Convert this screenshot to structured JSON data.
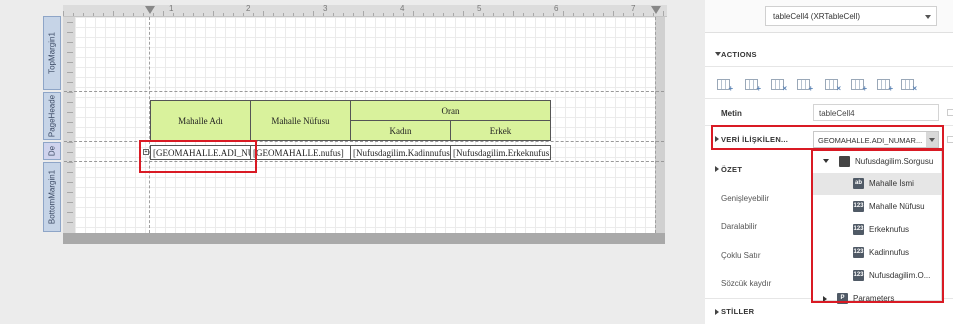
{
  "ruler": {
    "labels": [
      "1",
      "2",
      "3",
      "4",
      "5",
      "6",
      "7"
    ]
  },
  "bands": {
    "top_margin": "TopMargin1",
    "page_header": "PageHeade",
    "detail": "De",
    "bottom_margin": "BottomMargin1"
  },
  "table": {
    "headers": {
      "mahalle_adi": "Mahalle Adı",
      "mahalle_nufusu": "Mahalle Nüfusu",
      "oran": "Oran",
      "kadin": "Kadın",
      "erkek": "Erkek"
    },
    "detail_row": [
      "[GEOMAHALLE.ADI_NU",
      "[GEOMAHALLE.nufus]",
      "[Nufusdagilim.Kadinnufus]",
      "[Nufusdagilim.Erkeknufus]"
    ]
  },
  "colors": {
    "header_fill": "#d9f29c",
    "highlight": "#d91a24",
    "band_tab": "#c6d4e7"
  },
  "panel": {
    "selector_value": "tableCell4 (XRTableCell)",
    "actions_header": "ACTIONS",
    "action_icons": [
      "insert-row-above-icon",
      "insert-row-below-icon",
      "delete-row-icon",
      "insert-cell-icon",
      "delete-cell-icon",
      "insert-column-left-icon",
      "insert-column-right-icon",
      "delete-column-icon"
    ],
    "metin_label": "Metin",
    "metin_value": "tableCell4",
    "veri_iliskileri_label": "VERİ İLİŞKİLEN...",
    "veri_iliskileri_value": "GEOMAHALLE.ADI_NUMAR...",
    "ozet_label": "ÖZET",
    "genisleyebilir_label": "Genişleyebilir",
    "daralabilir_label": "Daralabilir",
    "coklu_satir_label": "Çoklu Satır",
    "sozcuk_kaydir_label": "Sözcük kaydır",
    "stiller_label": "STİLLER"
  },
  "tree": {
    "root": "Nufusdagilim.Sorgusu",
    "items": [
      {
        "label": "Mahalle İsmi",
        "icon": "ab",
        "selected": true
      },
      {
        "label": "Mahalle Nüfusu",
        "icon": "123",
        "selected": false
      },
      {
        "label": "Erkeknufus",
        "icon": "123",
        "selected": false
      },
      {
        "label": "Kadinnufus",
        "icon": "123",
        "selected": false
      },
      {
        "label": "Nufusdagilim.O...",
        "icon": "123",
        "selected": false
      }
    ],
    "parameters": "Parameters"
  }
}
